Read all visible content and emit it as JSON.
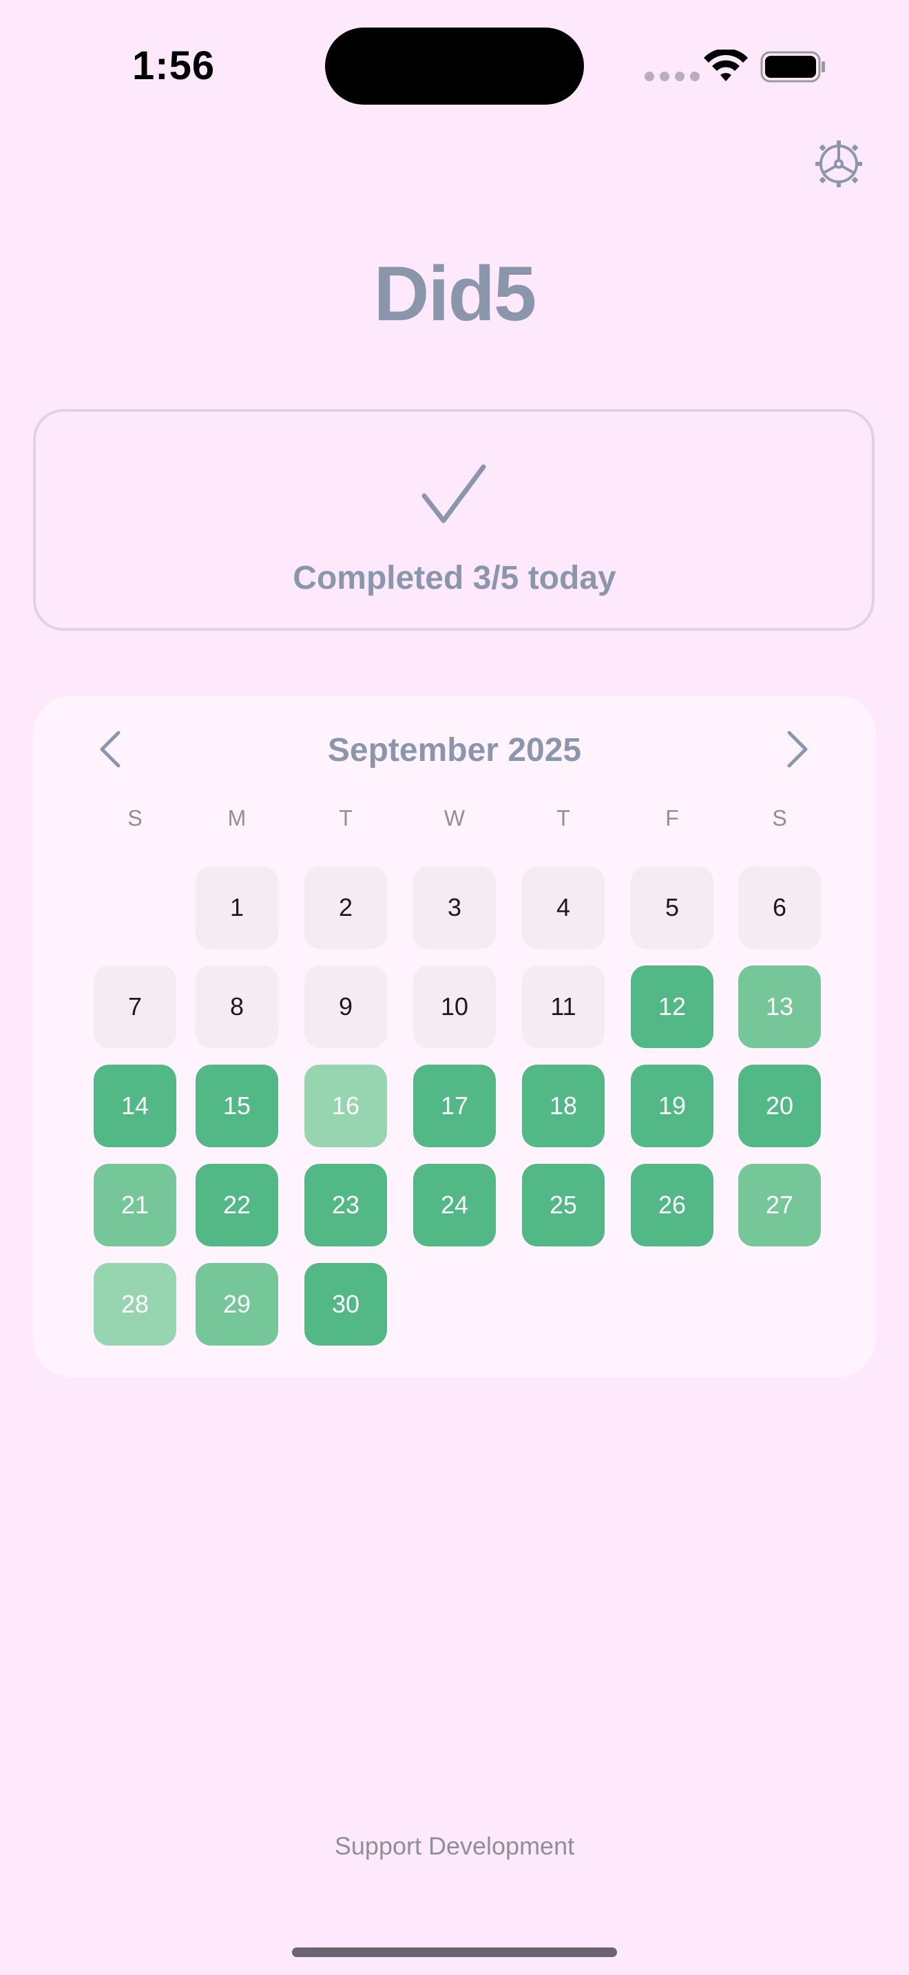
{
  "status_bar": {
    "time": "1:56"
  },
  "app": {
    "title": "Did5",
    "settings_icon": "gear-icon"
  },
  "status_card": {
    "icon": "checkmark-icon",
    "text": "Completed 3/5 today"
  },
  "calendar": {
    "month_label": "September 2025",
    "prev_icon": "chevron-left-icon",
    "next_icon": "chevron-right-icon",
    "weekdays": [
      "S",
      "M",
      "T",
      "W",
      "T",
      "F",
      "S"
    ],
    "first_weekday_index": 1,
    "days": [
      {
        "label": "1",
        "level": 0
      },
      {
        "label": "2",
        "level": 0
      },
      {
        "label": "3",
        "level": 0
      },
      {
        "label": "4",
        "level": 0
      },
      {
        "label": "5",
        "level": 0
      },
      {
        "label": "6",
        "level": 0
      },
      {
        "label": "7",
        "level": 0
      },
      {
        "label": "8",
        "level": 0
      },
      {
        "label": "9",
        "level": 0
      },
      {
        "label": "10",
        "level": 0
      },
      {
        "label": "11",
        "level": 0
      },
      {
        "label": "12",
        "level": 3
      },
      {
        "label": "13",
        "level": 2
      },
      {
        "label": "14",
        "level": 3
      },
      {
        "label": "15",
        "level": 3
      },
      {
        "label": "16",
        "level": 1
      },
      {
        "label": "17",
        "level": 3
      },
      {
        "label": "18",
        "level": 3
      },
      {
        "label": "19",
        "level": 3
      },
      {
        "label": "20",
        "level": 3
      },
      {
        "label": "21",
        "level": 2
      },
      {
        "label": "22",
        "level": 3
      },
      {
        "label": "23",
        "level": 3
      },
      {
        "label": "24",
        "level": 3
      },
      {
        "label": "25",
        "level": 3
      },
      {
        "label": "26",
        "level": 3
      },
      {
        "label": "27",
        "level": 2
      },
      {
        "label": "28",
        "level": 1
      },
      {
        "label": "29",
        "level": 2
      },
      {
        "label": "30",
        "level": 3
      }
    ],
    "colors": {
      "empty": "#f5ecf3",
      "level_1": "#97d5b0",
      "level_2": "#75c699",
      "level_3": "#52b886"
    }
  },
  "footer": {
    "support_label": "Support Development"
  }
}
